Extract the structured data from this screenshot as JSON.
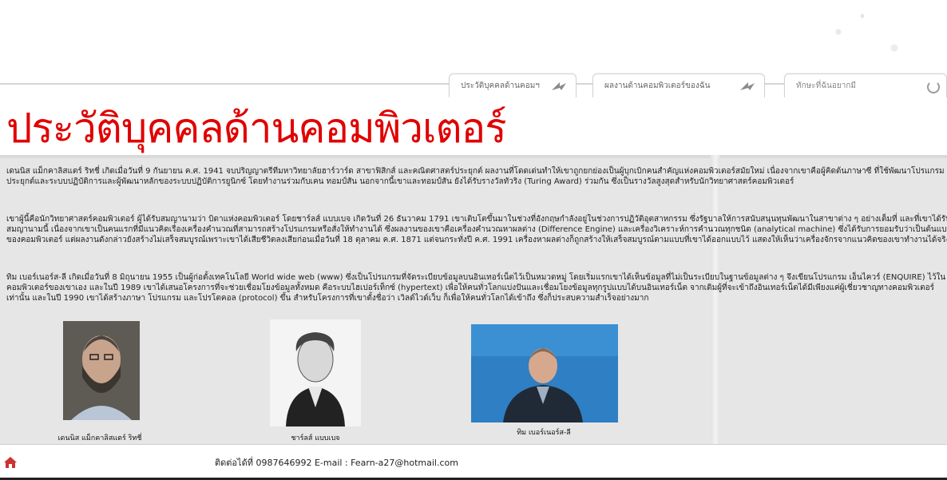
{
  "tabs": {
    "bio": "ประวัติบุคคลด้านคอมฯ",
    "works": "ผลงานด้านคอมพิวเตอร์ของฉัน",
    "search_placeholder": "ทักษะที่ฉันอยากมี"
  },
  "title": "ประวัติบุคคลด้านคอมพิวเตอร์",
  "paragraphs": [
    "เดนนิส แม็กคาลิสแตร์ ริทชี่ เกิดเมื่อวันที่ 9 กันยายน ค.ศ. 1941 จบปริญญาตรีทีมหาวิทยาลัยฮาร์วาร์ด สาขาฟิสิกส์ และคณิตศาสตร์ประยุกต์ ผลงานที่โดดเด่นทำให้เขาถูกยกย่องเป็นผู้บุกเบิกคนสำคัญแห่งคอมพิวเตอร์สมัยใหม่ เนื่องจากเขาคือผู้คิดต้นภาษาซี ที่ใช้พัฒนาโปรแกรมประยุกต์และระบบปฏิบัติการและผู้พัฒนาหลักของระบบปฏิบัติการยูนิกซ์ โดยทำงานร่วมกับเคน ทอมป์สัน นอกจากนี้เขาและทอมป์สัน ยังได้รับรางวัลทัวริง (Turing Award) ร่วมกัน ซึ่งเป็นรางวัลสูงสุดสำหรับนักวิทยาศาสตร์คอมพิวเตอร์",
    "เขาผู้นี้คือนักวิทยาศาสตร์คอมพิวเตอร์ ผู้ได้รับสมญานามว่า บิดาแห่งคอมพิวเตอร์ โดยชาร์ลส์ แบบเบจ เกิดวันที่ 26 ธันวาคม 1791 เขาเติบโตขึ้นมาในช่วงที่อังกฤษกำลังอยู่ในช่วงการปฏิวัติอุตสาหกรรม ซึ่งรัฐบาลให้การสนับสนุนทุนพัฒนาในสาขาต่าง ๆ อย่างเต็มที่ และที่เขาได้รับสมญานามนี้ เนื่องจากเขาเป็นคนแรกที่มีแนวคิดเรื่องเครื่องคำนวณที่สามารถสร้างโปรแกรมหรือสั่งให้ทำงานได้ ซึ่งผลงานของเขาคือเครื่องคำนวณหาผลต่าง (Difference Engine) และเครื่องวิเคราะห์การคำนวณทุกชนิด (analytical machine) ซึ่งได้รับการยอมรับว่าเป็นต้นแบบของคอมพิวเตอร์ แต่ผลงานดังกล่าวยังสร้างไม่เสร็จสมบูรณ์เพราะเขาได้เสียชีวิตลงเสียก่อนเมื่อวันที่ 18 ตุลาคม ค.ศ. 1871 แต่จนกระทั่งปี ค.ศ. 1991 เครื่องหาผลต่างก็ถูกสร้างให้เสร็จสมบูรณ์ตามแบบที่เขาได้ออกแบบไว้ แสดงให้เห็นว่าเครื่องจักรจากแนวคิดของเขาทำงานได้จริง",
    "ทิม เบอร์เนอร์ส-ลี เกิดเมื่อวันที่ 8 มิถุนายน 1955 เป็นผู้ก่อตั้งเทคโนโลยี World wide web (www) ซึ่งเป็นโปรแกรมที่จัดระเบียบข้อมูลบนอินเทอร์เน็ตไว้เป็นหมวดหมู่ โดยเริ่มแรกเขาได้เห็นข้อมูลที่ไม่เป็นระเบียบในฐานข้อมูลต่าง ๆ จึงเขียนโปรแกรม เอ็นไควร์ (ENQUIRE) ไว้ในคอมพิวเตอร์ของเขาเอง และในปี 1989 เขาได้เสนอโครงการที่จะช่วยเชื่อมโยงข้อมูลทั้งหมด คือระบบไฮเปอร์เท็กซ์ (hypertext) เพื่อให้คนทั่วโลกแบ่งปันและเชื่อมโยงข้อมูลทุกรูปแบบได้บนอินเทอร์เน็ต จากเดิมผู้ที่จะเข้าถึงอินเทอร์เน็ตได้มีเพียงแค่ผู้เชี่ยวชาญทางคอมพิวเตอร์เท่านั้น และในปี 1990 เขาได้สร้างภาษา โปรแกรม และโปรโตคอล (protocol) ขึ้น สำหรับโครงการที่เขาตั้งชื่อว่า เวิลด์ไวด์เว็บ ก็เพื่อให้คนทั่วโลกได้เข้าถึง ซึ่งก็ประสบความสำเร็จอย่างมาก"
  ],
  "people": [
    {
      "caption": "เดนนิส แม็กคาลิสแตร์ ริทชี่"
    },
    {
      "caption": "ชาร์ลส์ แบบเบจ"
    },
    {
      "caption": "ทิม เบอร์เนอร์ส-ลี"
    }
  ],
  "footer": {
    "contact": "ติดต่อได้ที่ 0987646992 E-mail : Fearn-a27@hotmail.com"
  },
  "colors": {
    "title_red": "#e00000",
    "content_bg": "#e6e6e6"
  }
}
